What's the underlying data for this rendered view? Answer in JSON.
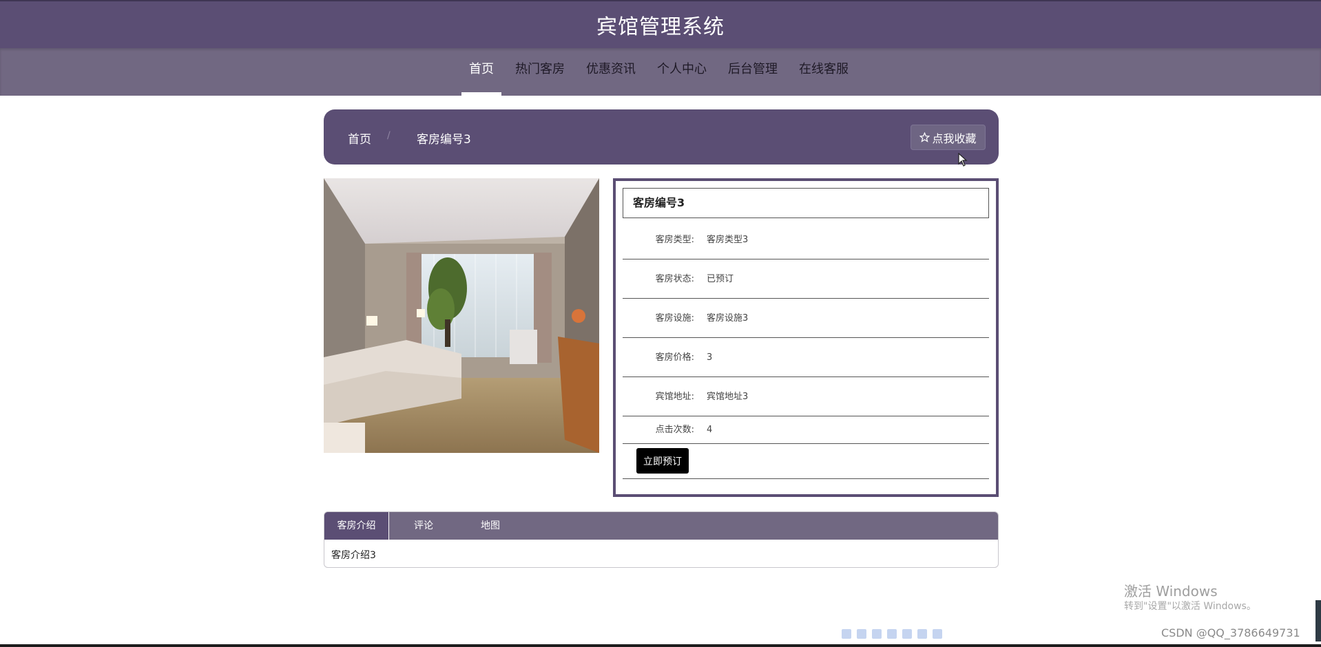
{
  "header": {
    "title": "宾馆管理系统"
  },
  "nav": {
    "items": [
      {
        "label": "首页",
        "active": true
      },
      {
        "label": "热门客房",
        "active": false
      },
      {
        "label": "优惠资讯",
        "active": false
      },
      {
        "label": "个人中心",
        "active": false
      },
      {
        "label": "后台管理",
        "active": false
      },
      {
        "label": "在线客服",
        "active": false
      }
    ]
  },
  "breadcrumb": {
    "home": "首页",
    "separator": "/",
    "current": "客房编号3",
    "favorite_label": "点我收藏"
  },
  "detail": {
    "title": "客房编号3",
    "rows": [
      {
        "label": "客房类型:",
        "value": "客房类型3"
      },
      {
        "label": "客房状态:",
        "value": "已预订"
      },
      {
        "label": "客房设施:",
        "value": "客房设施3"
      },
      {
        "label": "客房价格:",
        "value": "3"
      },
      {
        "label": "宾馆地址:",
        "value": "宾馆地址3"
      },
      {
        "label": "点击次数:",
        "value": "4"
      }
    ],
    "book_label": "立即预订"
  },
  "tabs": {
    "items": [
      {
        "label": "客房介绍",
        "active": true
      },
      {
        "label": "评论",
        "active": false
      },
      {
        "label": "地图",
        "active": false
      }
    ],
    "content": "客房介绍3"
  },
  "overlay": {
    "activate_title": "激活 Windows",
    "activate_sub": "转到\"设置\"以激活 Windows。",
    "csdn": "CSDN @QQ_3786649731"
  },
  "colors": {
    "header": "#5b4e74",
    "nav": "#716882",
    "accent": "#5b4e74"
  }
}
